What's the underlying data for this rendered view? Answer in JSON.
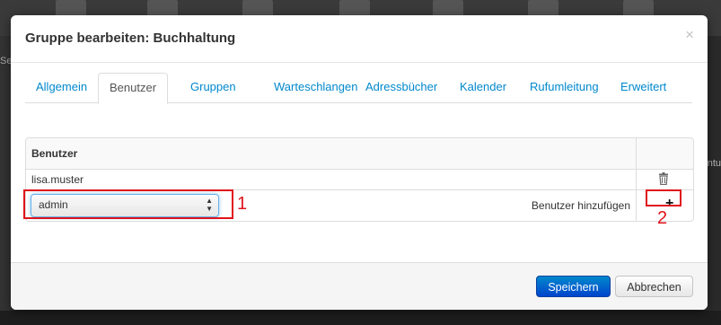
{
  "modal": {
    "title": "Gruppe bearbeiten: Buchhaltung",
    "close_glyph": "×"
  },
  "tabs": [
    {
      "label": "Allgemein"
    },
    {
      "label": "Benutzer",
      "active": true
    },
    {
      "label": "Gruppen"
    },
    {
      "label": "Warteschlangen"
    },
    {
      "label": "Adressbücher"
    },
    {
      "label": "Kalender"
    },
    {
      "label": "Rufumleitung"
    },
    {
      "label": "Erweitert"
    }
  ],
  "users_table": {
    "header": "Benutzer",
    "rows": [
      {
        "name": "lisa.muster",
        "action_icon": "trash-icon"
      }
    ],
    "add_row": {
      "select_value": "admin",
      "label": "Benutzer hinzufügen",
      "add_glyph": "+"
    }
  },
  "annotations": [
    {
      "label": "1"
    },
    {
      "label": "2"
    }
  ],
  "footer": {
    "save_label": "Speichern",
    "cancel_label": "Abbrechen"
  },
  "background": {
    "left_fragment": "Se",
    "right_fragment": "ntu"
  },
  "colors": {
    "primary": "#0088cc",
    "annotation": "#e0131b"
  }
}
